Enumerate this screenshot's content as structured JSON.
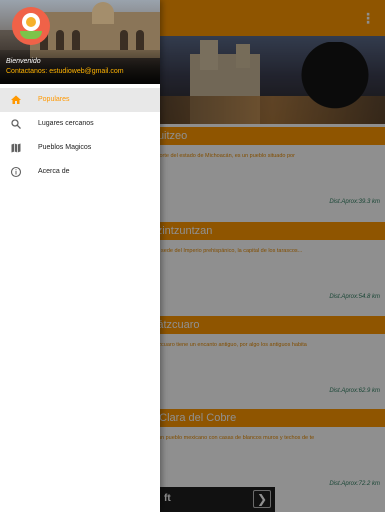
{
  "app": {
    "cards": [
      {
        "title": "Cuitzeo",
        "description": "Al norte del estado de Michoacán, es un pueblo situado por",
        "distance": "Dist.Aprox:39.3 km"
      },
      {
        "title": "Tzintzuntzan",
        "description": "Fue sede del Imperio prehispánico, la capital de los tarascos...",
        "distance": "Dist.Aprox:54.8 km"
      },
      {
        "title": "Pátzcuaro",
        "description": "Pátzcuaro tiene un encanto antiguo, por algo los antiguos habita",
        "distance": "Dist.Aprox:62.9 km"
      },
      {
        "title": "a Clara del Cobre",
        "description": "Es un pueblo mexicano con casas de blancos muros y techos de te",
        "distance": "Dist.Aprox:72.2 km"
      }
    ],
    "ad_label": "ft",
    "ad_arrow": "❯",
    "menu_glyph": "⋮"
  },
  "drawer": {
    "welcome": "Bienvenido",
    "contact": "Contactanos: estudioweb@gmail.com",
    "items": [
      {
        "label": "Populares",
        "icon": "home-icon",
        "active": true
      },
      {
        "label": "Lugares cercanos",
        "icon": "search-icon",
        "active": false
      },
      {
        "label": "Pueblos Magicos",
        "icon": "map-icon",
        "active": false
      },
      {
        "label": "Acerca de",
        "icon": "info-icon",
        "active": false
      }
    ]
  },
  "colors": {
    "accent": "#ff9800",
    "contact": "#ffb300",
    "active_bg": "#e8e8e8",
    "distance": "#2e7d60"
  }
}
